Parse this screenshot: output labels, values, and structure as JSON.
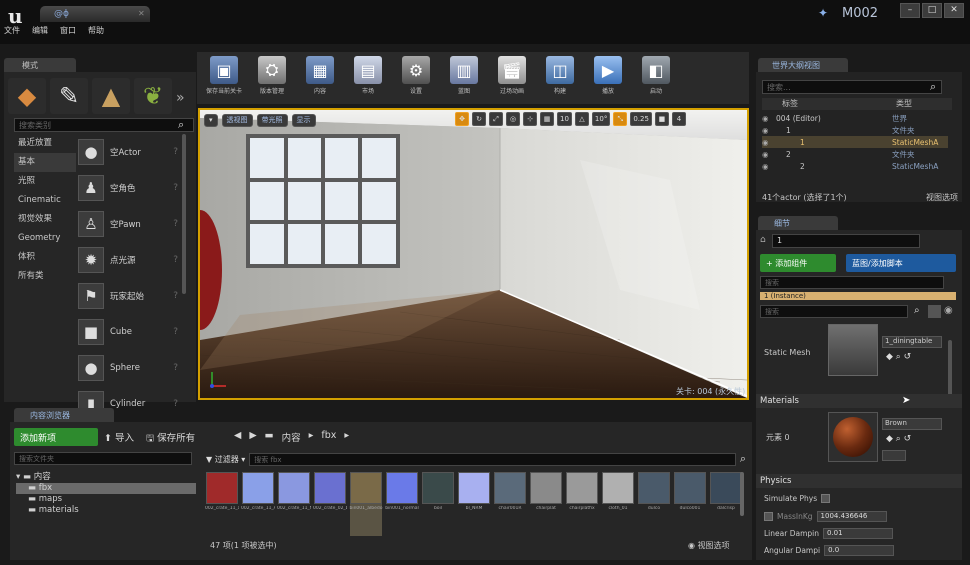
{
  "window": {
    "logo": "u",
    "project_tab": "@ɸ",
    "project_name": "M002",
    "menu": [
      "文件",
      "编辑",
      "窗口",
      "帮助"
    ]
  },
  "modes": {
    "tab_label": "模式",
    "search_placeholder": "搜索类别",
    "categories": [
      "最近放置",
      "基本",
      "光照",
      "Cinematic",
      "视觉效果",
      "Geometry",
      "体积",
      "所有类"
    ],
    "selected_category": "基本",
    "actors": [
      {
        "name": "空Actor",
        "icon": "sphere-icon"
      },
      {
        "name": "空角色",
        "icon": "character-icon"
      },
      {
        "name": "空Pawn",
        "icon": "pawn-icon"
      },
      {
        "name": "点光源",
        "icon": "point-light-icon"
      },
      {
        "name": "玩家起始",
        "icon": "player-start-icon"
      },
      {
        "name": "Cube",
        "icon": "cube-icon"
      },
      {
        "name": "Sphere",
        "icon": "sphere-icon"
      },
      {
        "name": "Cylinder",
        "icon": "cylinder-icon"
      }
    ]
  },
  "toolbar": {
    "buttons": [
      {
        "label": "保存当前关卡",
        "icon": "save-icon"
      },
      {
        "label": "版本管理",
        "icon": "source-control-icon"
      },
      {
        "label": "内容",
        "icon": "content-icon"
      },
      {
        "label": "市场",
        "icon": "marketplace-icon"
      },
      {
        "label": "设置",
        "icon": "settings-icon"
      },
      {
        "label": "蓝图",
        "icon": "blueprint-icon"
      },
      {
        "label": "过场动画",
        "icon": "cinematics-icon"
      },
      {
        "label": "构建",
        "icon": "build-icon"
      },
      {
        "label": "播放",
        "icon": "play-icon"
      },
      {
        "label": "启动",
        "icon": "launch-icon"
      }
    ]
  },
  "viewport": {
    "pills": [
      "透视图",
      "带光照",
      "显示"
    ],
    "tools": [
      "10",
      "10°",
      "0.25",
      "4"
    ],
    "level_label": "关卡: 004 (永久性)"
  },
  "outliner": {
    "tab_label": "世界大纲视图",
    "search_placeholder": "搜索...",
    "col_label": "标签",
    "col_type": "类型",
    "rows": [
      {
        "label": "004 (Editor)",
        "type": "世界",
        "sel": false
      },
      {
        "label": "1",
        "type": "文件夹",
        "sel": false
      },
      {
        "label": "1",
        "type": "StaticMeshA",
        "sel": true
      },
      {
        "label": "2",
        "type": "文件夹",
        "sel": false
      },
      {
        "label": "2",
        "type": "StaticMeshA",
        "sel": false
      }
    ],
    "footer_count": "41个actor (选择了1个)",
    "footer_view": "视图选项"
  },
  "details": {
    "tab_label": "细节",
    "name_value": "1",
    "add_component": "+ 添加组件",
    "blueprint_btn": "蓝图/添加脚本",
    "search_placeholder": "搜索",
    "component_sel": "1 (Instance)",
    "search2_placeholder": "搜索",
    "static_mesh_label": "Static Mesh",
    "static_mesh_value": "1_diningtable",
    "materials_header": "Materials",
    "element_label": "元素 0",
    "material_value": "Brown",
    "physics_header": "Physics",
    "simulate_physics": "Simulate Phys",
    "mass": "MassInKg",
    "mass_value": "1004.436646",
    "linear_damping": "Linear Dampin",
    "linear_damping_value": "0.01",
    "angular_damping": "Angular Dampi",
    "angular_damping_value": "0.0"
  },
  "content_browser": {
    "tab_label": "内容浏览器",
    "add_new": "添加新项",
    "import": "导入",
    "save_all": "保存所有",
    "path_root": "内容",
    "path_sub": "fbx",
    "folder_search_placeholder": "搜索文件夹",
    "folders": [
      {
        "name": "内容",
        "sel": false
      },
      {
        "name": "fbx",
        "sel": true
      },
      {
        "name": "maps",
        "sel": false
      },
      {
        "name": "materials",
        "sel": false
      }
    ],
    "filter_label": "过滤器",
    "asset_search_placeholder": "搜索 fbx",
    "assets": [
      {
        "name": "002_crate_11_ao",
        "color": "#a02a2a"
      },
      {
        "name": "002_crate_11_AL_N(002)",
        "color": "#8aa0e8"
      },
      {
        "name": "002_crate_11_NRM",
        "color": "#8a98e0"
      },
      {
        "name": "002_crate_02_bump_NRM",
        "color": "#6a70d0"
      },
      {
        "name": "bin001_albedo",
        "color": "#7a6a48"
      },
      {
        "name": "bin001_normal",
        "color": "#6a7ae8"
      },
      {
        "name": "boil",
        "color": "#3a4a4a"
      },
      {
        "name": "bl_NRM",
        "color": "#a8b0f0"
      },
      {
        "name": "chair001R",
        "color": "#5a6a7a"
      },
      {
        "name": "chairplat",
        "color": "#8a8a8a"
      },
      {
        "name": "chairplatfix",
        "color": "#9a9a9a"
      },
      {
        "name": "cloth_01",
        "color": "#b0b0b0"
      },
      {
        "name": "dulco",
        "color": "#4a5a6a"
      },
      {
        "name": "dulco001",
        "color": "#4a5a6a"
      },
      {
        "name": "dalcrisp",
        "color": "#3a4a5a"
      }
    ],
    "status": "47 项(1 项被选中)",
    "view_options": "视图选项"
  }
}
